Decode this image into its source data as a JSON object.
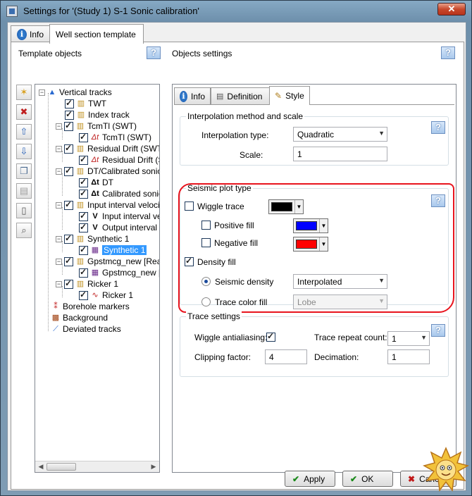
{
  "window": {
    "title": "Settings for '(Study 1) S-1 Sonic calibration'"
  },
  "main_tabs": [
    {
      "label": "Info"
    },
    {
      "label": "Well section template"
    }
  ],
  "left": {
    "header": "Template objects",
    "tree": [
      {
        "label": "Vertical tracks"
      },
      {
        "label": "TWT"
      },
      {
        "label": "Index track"
      },
      {
        "label": "TcmTl (SWT)"
      },
      {
        "label": "TcmTl (SWT)"
      },
      {
        "label": "Residual Drift (SWT)"
      },
      {
        "label": "Residual Drift (SW"
      },
      {
        "label": "DT/Calibrated sonic lo"
      },
      {
        "label": "DT"
      },
      {
        "label": "Calibrated sonic lo"
      },
      {
        "label": "Input interval velocity"
      },
      {
        "label": "Input interval velo"
      },
      {
        "label": "Output interval ve"
      },
      {
        "label": "Synthetic 1"
      },
      {
        "label": "Synthetic 1"
      },
      {
        "label": "Gpstmcg_new [Realiz"
      },
      {
        "label": "Gpstmcg_new [Re"
      },
      {
        "label": "Ricker 1"
      },
      {
        "label": "Ricker 1"
      },
      {
        "label": "Borehole markers"
      },
      {
        "label": "Background"
      },
      {
        "label": "Deviated tracks"
      }
    ]
  },
  "right": {
    "header": "Objects settings",
    "tabs": [
      {
        "label": "Info"
      },
      {
        "label": "Definition"
      },
      {
        "label": "Style"
      }
    ],
    "interp": {
      "title": "Interpolation method and scale",
      "type_label": "Interpolation type:",
      "type_value": "Quadratic",
      "scale_label": "Scale:",
      "scale_value": "1"
    },
    "seismic": {
      "title": "Seismic plot type",
      "wiggle_trace": "Wiggle trace",
      "wiggle_color": "#000000",
      "positive_fill": "Positive fill",
      "positive_color": "#0000ff",
      "negative_fill": "Negative fill",
      "negative_color": "#ff0000",
      "density_fill": "Density fill",
      "seismic_density": "Seismic density",
      "density_value": "Interpolated",
      "trace_color_fill": "Trace color fill",
      "trace_color_value": "Lobe"
    },
    "trace": {
      "title": "Trace settings",
      "wiggle_antialiasing": "Wiggle antialiasing:",
      "trace_repeat_label": "Trace repeat count:",
      "trace_repeat_value": "1",
      "clipping_label": "Clipping factor:",
      "clipping_value": "4",
      "decimation_label": "Decimation:",
      "decimation_value": "1"
    }
  },
  "buttons": {
    "apply": "Apply",
    "ok": "OK",
    "cancel": "Cancel"
  }
}
